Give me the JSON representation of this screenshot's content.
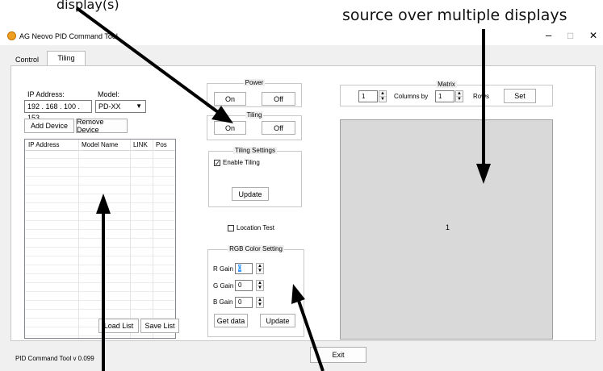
{
  "annotations": {
    "top_left_partial": "display(s)",
    "top_right": "source over multiple displays"
  },
  "window": {
    "title": "AG Neovo PID Command Tool",
    "icon": "app-logo-icon",
    "controls": {
      "minimize": "–",
      "maximize": "□",
      "close": "✕"
    }
  },
  "tabs": [
    {
      "label": "Control",
      "active": false
    },
    {
      "label": "Tiling",
      "active": true
    }
  ],
  "left_panel": {
    "ip_label": "IP Address:",
    "ip_value": "192 . 168 . 100 . 153",
    "model_label": "Model:",
    "model_value": "PD-XX",
    "add_device": "Add Device",
    "remove_device": "Remove Device",
    "table_headers": [
      "IP Address",
      "Model Name",
      "LINK",
      "Pos"
    ],
    "load_list": "Load List",
    "save_list": "Save List"
  },
  "power": {
    "title": "Power",
    "on": "On",
    "off": "Off"
  },
  "tiling": {
    "title": "Tiling",
    "on": "On",
    "off": "Off"
  },
  "tiling_settings": {
    "title": "Tiling Settings",
    "enable_label": "Enable Tiling",
    "enable_checked": true,
    "update": "Update"
  },
  "location_test": {
    "label": "Location Test",
    "checked": false
  },
  "rgb": {
    "title": "RGB Color Setting",
    "r_label": "R Gain",
    "r_value": "0",
    "g_label": "G Gain",
    "g_value": "0",
    "b_label": "B Gain",
    "b_value": "0",
    "get_data": "Get data",
    "update": "Update"
  },
  "matrix": {
    "title": "Matrix",
    "columns_value": "1",
    "columns_by": "Columns by",
    "rows_value": "1",
    "rows_label": "Rows",
    "set": "Set",
    "preview_cell": "1"
  },
  "footer": {
    "version": "PID Command Tool v 0.099",
    "exit": "Exit"
  },
  "colors": {
    "window_bg": "#f0f0f0",
    "preview_bg": "#d9d9d9",
    "selection": "#3399ff"
  }
}
